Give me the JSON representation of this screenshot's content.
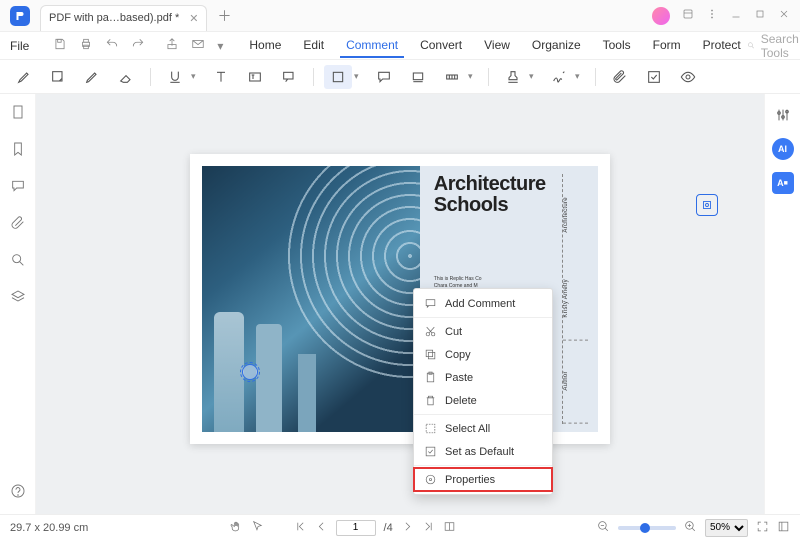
{
  "titlebar": {
    "tab_name": "PDF with pa…based).pdf *"
  },
  "menu": {
    "file": "File",
    "tabs": [
      "Home",
      "Edit",
      "Comment",
      "Convert",
      "View",
      "Organize",
      "Tools",
      "Form",
      "Protect"
    ],
    "active_index": 2,
    "search_placeholder": "Search Tools"
  },
  "doc": {
    "title_line1": "Architecture",
    "title_line2": "Schools",
    "side_labels": [
      "Architecture",
      "Kristy Ametly",
      "Author"
    ],
    "body_snippet": "This is Replic Has Co Chara Corne and M"
  },
  "context_menu": {
    "items": [
      {
        "icon": "comment",
        "label": "Add Comment"
      },
      {
        "icon": "cut",
        "label": "Cut"
      },
      {
        "icon": "copy",
        "label": "Copy"
      },
      {
        "icon": "paste",
        "label": "Paste"
      },
      {
        "icon": "delete",
        "label": "Delete"
      },
      {
        "icon": "selectall",
        "label": "Select All"
      },
      {
        "icon": "default",
        "label": "Set as Default"
      },
      {
        "icon": "props",
        "label": "Properties"
      }
    ],
    "highlight_index": 7
  },
  "status": {
    "dimensions": "29.7 x 20.99 cm",
    "page": "1",
    "page_total": "/4",
    "zoom": "50%"
  }
}
